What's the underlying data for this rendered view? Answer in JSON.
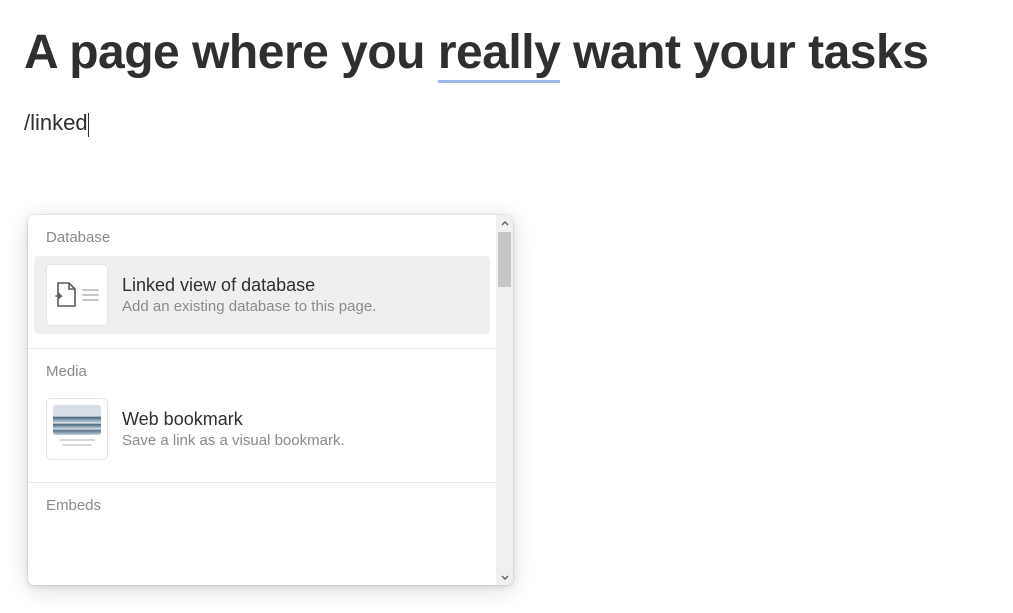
{
  "page": {
    "title_pre": "A page where you ",
    "title_underlined": "really",
    "title_post": " want your tasks"
  },
  "editor": {
    "command_text": "/linked"
  },
  "menu": {
    "sections": [
      {
        "header": "Database",
        "items": [
          {
            "icon": "linked-database-icon",
            "title": "Linked view of database",
            "description": "Add an existing database to this page.",
            "selected": true
          }
        ]
      },
      {
        "header": "Media",
        "items": [
          {
            "icon": "web-bookmark-icon",
            "title": "Web bookmark",
            "description": "Save a link as a visual bookmark.",
            "selected": false
          }
        ]
      },
      {
        "header": "Embeds",
        "items": []
      }
    ]
  }
}
